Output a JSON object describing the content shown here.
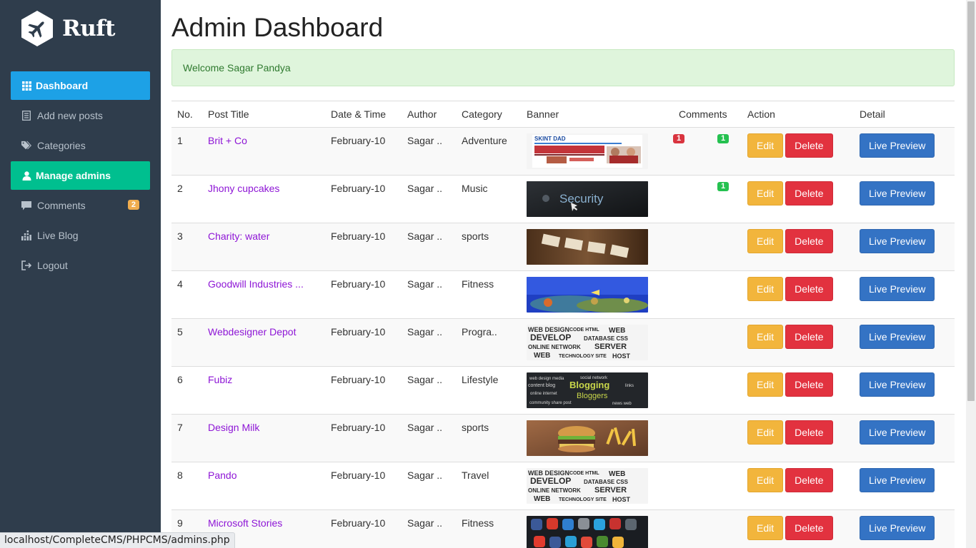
{
  "brand": {
    "name": "Ruft"
  },
  "sidebar": {
    "items": [
      {
        "label": "Dashboard",
        "icon": "grid-icon",
        "state": "active-blue"
      },
      {
        "label": "Add new posts",
        "icon": "list-icon",
        "state": ""
      },
      {
        "label": "Categories",
        "icon": "tags-icon",
        "state": ""
      },
      {
        "label": "Manage admins",
        "icon": "user-icon",
        "state": "active-green"
      },
      {
        "label": "Comments",
        "icon": "comment-icon",
        "state": "",
        "badge": "2"
      },
      {
        "label": "Live Blog",
        "icon": "chart-icon",
        "state": ""
      },
      {
        "label": "Logout",
        "icon": "logout-icon",
        "state": ""
      }
    ]
  },
  "main": {
    "title": "Admin Dashboard",
    "alert": "Welcome Sagar Pandya",
    "columns": [
      "No.",
      "Post Title",
      "Date & Time",
      "Author",
      "Category",
      "Banner",
      "Comments",
      "Action",
      "Detail"
    ],
    "buttons": {
      "edit": "Edit",
      "delete": "Delete",
      "preview": "Live Preview"
    },
    "rows": [
      {
        "no": "1",
        "title": "Brit + Co",
        "date": "February-10",
        "author": "Sagar ..",
        "category": "Adventure",
        "banner": "skint-dad",
        "unapproved": "1",
        "approved": "1"
      },
      {
        "no": "2",
        "title": "Jhony cupcakes",
        "date": "February-10",
        "author": "Sagar ..",
        "category": "Music",
        "banner": "security",
        "unapproved": "",
        "approved": "1"
      },
      {
        "no": "3",
        "title": "Charity: water",
        "date": "February-10",
        "author": "Sagar ..",
        "category": "sports",
        "banner": "blog-blocks",
        "unapproved": "",
        "approved": ""
      },
      {
        "no": "4",
        "title": "Goodwill Industries ...",
        "date": "February-10",
        "author": "Sagar ..",
        "category": "Fitness",
        "banner": "coral-reef",
        "unapproved": "",
        "approved": ""
      },
      {
        "no": "5",
        "title": "Webdesigner Depot",
        "date": "February-10",
        "author": "Sagar ..",
        "category": "Progra..",
        "banner": "word-cloud",
        "unapproved": "",
        "approved": ""
      },
      {
        "no": "6",
        "title": "Fubiz",
        "date": "February-10",
        "author": "Sagar ..",
        "category": "Lifestyle",
        "banner": "chalkboard",
        "unapproved": "",
        "approved": ""
      },
      {
        "no": "7",
        "title": "Design Milk",
        "date": "February-10",
        "author": "Sagar ..",
        "category": "sports",
        "banner": "burger",
        "unapproved": "",
        "approved": ""
      },
      {
        "no": "8",
        "title": "Pando",
        "date": "February-10",
        "author": "Sagar ..",
        "category": "Travel",
        "banner": "word-cloud",
        "unapproved": "",
        "approved": ""
      },
      {
        "no": "9",
        "title": "Microsoft Stories",
        "date": "February-10",
        "author": "Sagar ..",
        "category": "Fitness",
        "banner": "app-icons",
        "unapproved": "",
        "approved": ""
      }
    ]
  },
  "statusbar": {
    "url": "localhost/CompleteCMS/PHPCMS/admins.php"
  },
  "colors": {
    "sidebar": "#2f3d4c",
    "dashboard_active": "#1da1e6",
    "manage_active": "#00bf8f",
    "link": "#8e16d6",
    "edit": "#f2b53c",
    "delete": "#e2323f",
    "preview": "#3473c4"
  }
}
